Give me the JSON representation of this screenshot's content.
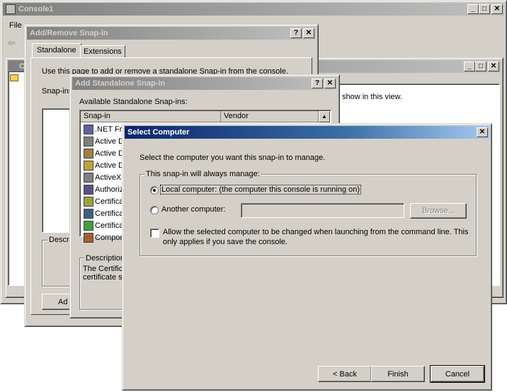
{
  "console": {
    "title": "Console1",
    "menu": {
      "file": "File"
    },
    "inner_title": "Co",
    "right_text": "show in this view."
  },
  "add_remove": {
    "title": "Add/Remove Snap-in",
    "tabs": [
      "Standalone",
      "Extensions"
    ],
    "intro": "Use this page to add or remove a standalone Snap-in from the console.",
    "snapins_label": "Snap-ins",
    "description_label": "Descri",
    "add_button": "Ad"
  },
  "add_standalone": {
    "title": "Add Standalone Snap-in",
    "available_label": "Available Standalone Snap-ins:",
    "columns": [
      "Snap-in",
      "Vendor"
    ],
    "rows": [
      ".NET Fr",
      "Active D",
      "Active D",
      "Active D",
      "ActiveX",
      "Authoriz",
      "Certifica",
      "Certifica",
      "Certifica",
      "Compon"
    ],
    "description_label": "Description",
    "description_text_1": "The Certifica",
    "description_text_2": "certificate st"
  },
  "select_computer": {
    "title": "Select Computer",
    "instruction": "Select the computer you want this snap-in to manage.",
    "group_label": "This snap-in will always manage:",
    "local_label": "Local computer:  (the computer this console is running on)",
    "another_label": "Another computer:",
    "another_value": "",
    "browse_label": "Browse...",
    "allow_label_line1": "Allow the selected computer to be changed when launching from the command line.  This",
    "allow_label_line2": "only applies if you save the console.",
    "back_label": "< Back",
    "finish_label": "Finish",
    "cancel_label": "Cancel",
    "local_selected": true,
    "allow_checked": false
  }
}
